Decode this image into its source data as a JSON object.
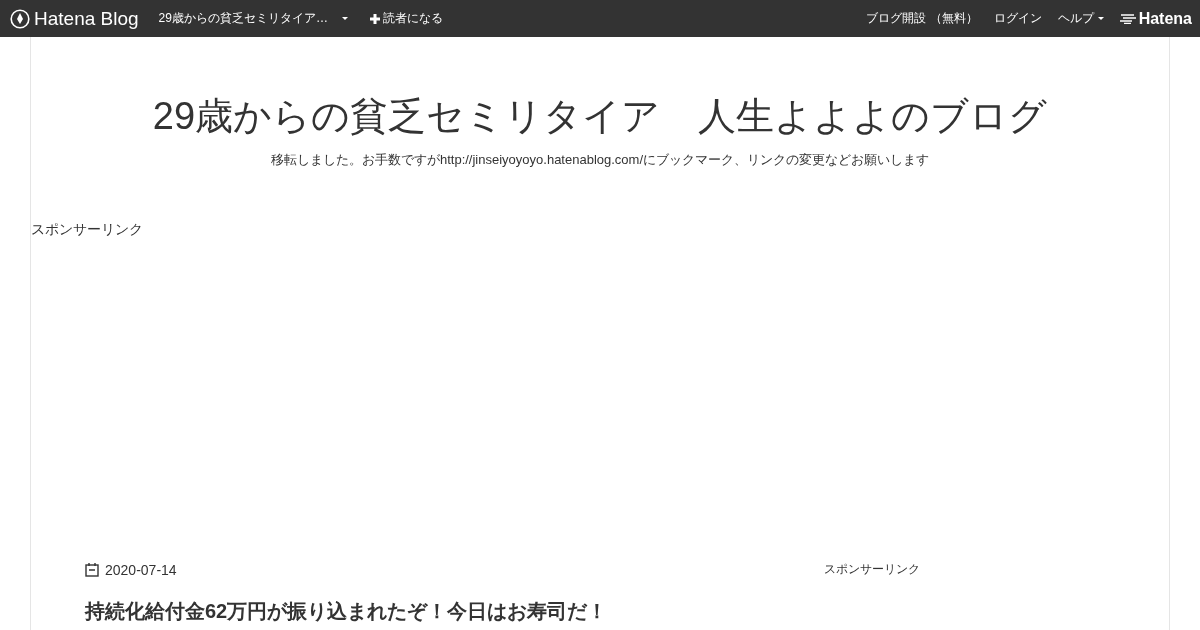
{
  "top_bar": {
    "logo": "Hatena Blog",
    "blog_menu": "29歳からの貧乏セミリタイア…",
    "subscribe": "読者になる",
    "links": [
      "ブログ開設 （無料）",
      "ログイン",
      "ヘルプ"
    ],
    "brand": "Hatena"
  },
  "header": {
    "title": "29歳からの貧乏セミリタイア　人生よよよのブログ",
    "description": "移転しました。お手数ですがhttp://jinseiyoyoyo.hatenablog.com/にブックマーク、リンクの変更などお願いします"
  },
  "sponsor_top": "スポンサーリンク",
  "article": {
    "date": "2020-07-14",
    "sponsor": "スポンサーリンク",
    "title": "持続化給付金62万円が振り込まれたぞ！今日はお寿司だ！"
  }
}
